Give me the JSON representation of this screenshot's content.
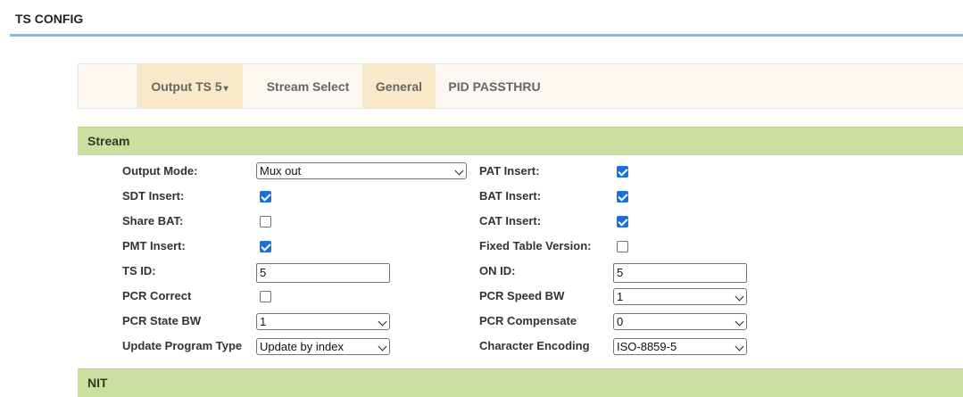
{
  "page": {
    "title": "TS CONFIG"
  },
  "tabs": {
    "output_ts": "Output TS 5",
    "stream_select": "Stream Select",
    "general": "General",
    "pid_passthru": "PID PASSTHRU"
  },
  "sections": {
    "stream": "Stream",
    "nit": "NIT"
  },
  "form": {
    "output_mode": {
      "label": "Output Mode:",
      "value": "Mux out"
    },
    "pat_insert": {
      "label": "PAT Insert:",
      "checked": true
    },
    "sdt_insert": {
      "label": "SDT Insert:",
      "checked": true
    },
    "bat_insert": {
      "label": "BAT Insert:",
      "checked": true
    },
    "share_bat": {
      "label": "Share BAT:",
      "checked": false
    },
    "cat_insert": {
      "label": "CAT Insert:",
      "checked": true
    },
    "pmt_insert": {
      "label": "PMT Insert:",
      "checked": true
    },
    "fixed_table_version": {
      "label": "Fixed Table Version:",
      "checked": false
    },
    "ts_id": {
      "label": "TS ID:",
      "value": "5"
    },
    "on_id": {
      "label": "ON ID:",
      "value": "5"
    },
    "pcr_correct": {
      "label": "PCR Correct",
      "checked": false
    },
    "pcr_speed_bw": {
      "label": "PCR Speed BW",
      "value": "1"
    },
    "pcr_state_bw": {
      "label": "PCR State BW",
      "value": "1"
    },
    "pcr_compensate": {
      "label": "PCR Compensate",
      "value": "0"
    },
    "update_program_type": {
      "label": "Update Program Type",
      "value": "Update by index"
    },
    "character_encoding": {
      "label": "Character Encoding",
      "value": "ISO-8859-5"
    }
  }
}
